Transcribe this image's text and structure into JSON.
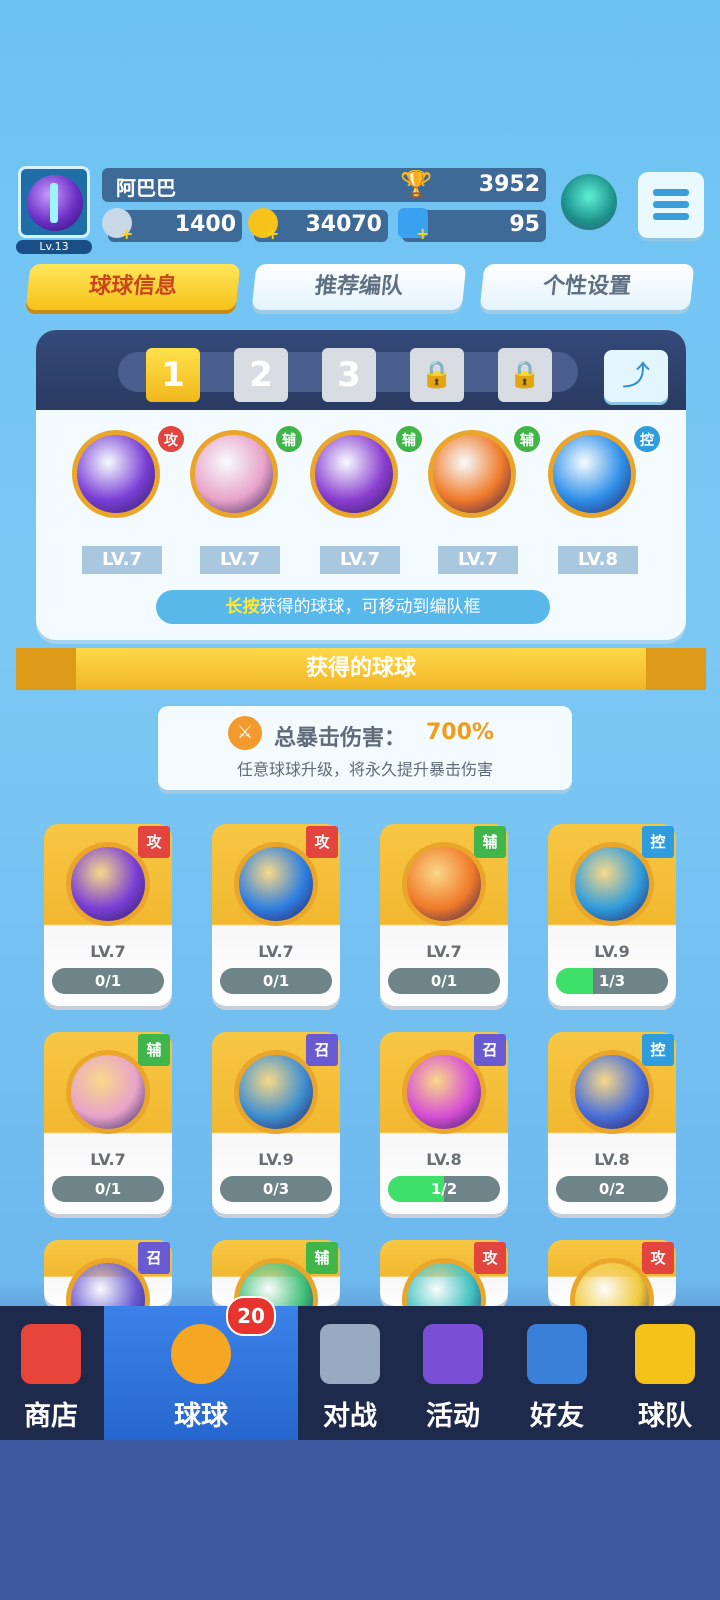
{
  "player": {
    "name": "阿巴巴",
    "level": "Lv.13",
    "trophies": "3952"
  },
  "resources": [
    {
      "name": "energy",
      "value": "1400",
      "icon": "energy-icon"
    },
    {
      "name": "gold",
      "value": "34070",
      "icon": "coin-icon"
    },
    {
      "name": "gems",
      "value": "95",
      "icon": "gem-icon"
    }
  ],
  "tabs": [
    "球球信息",
    "推荐编队",
    "个性设置"
  ],
  "team": {
    "slots": [
      "1",
      "2",
      "3",
      "🔒",
      "🔒"
    ],
    "balls": [
      {
        "type": "攻",
        "level": "LV.7",
        "color": "#7a3fd6"
      },
      {
        "type": "辅",
        "level": "LV.7",
        "color": "#e8a3c9"
      },
      {
        "type": "辅",
        "level": "LV.7",
        "color": "#8b3fd0"
      },
      {
        "type": "辅",
        "level": "LV.7",
        "color": "#f07a2a"
      },
      {
        "type": "控",
        "level": "LV.8",
        "color": "#2f8fe8"
      }
    ],
    "hint_key": "长按",
    "hint_text": "获得的球球，可移动到编队框"
  },
  "ribbon_title": "获得的球球",
  "crit": {
    "label": "总暴击伤害：",
    "value": "700%",
    "sub": "任意球球升级，将永久提升暴击伤害"
  },
  "collection": [
    {
      "type": "攻",
      "level": "LV.7",
      "progress": "0/1",
      "fill": 0,
      "color": "#7a3fd6"
    },
    {
      "type": "攻",
      "level": "LV.7",
      "progress": "0/1",
      "fill": 0,
      "color": "#2f7fe0"
    },
    {
      "type": "辅",
      "level": "LV.7",
      "progress": "0/1",
      "fill": 0,
      "color": "#f07a2a"
    },
    {
      "type": "控",
      "level": "LV.9",
      "progress": "1/3",
      "fill": 0.33,
      "color": "#2f9ddd"
    },
    {
      "type": "辅",
      "level": "LV.7",
      "progress": "0/1",
      "fill": 0,
      "color": "#e8a3c9"
    },
    {
      "type": "召",
      "level": "LV.9",
      "progress": "0/3",
      "fill": 0,
      "color": "#3f8fd0"
    },
    {
      "type": "召",
      "level": "LV.8",
      "progress": "1/2",
      "fill": 0.5,
      "color": "#d74fd6"
    },
    {
      "type": "控",
      "level": "LV.8",
      "progress": "0/2",
      "fill": 0,
      "color": "#4a6fd8"
    },
    {
      "type": "召",
      "level": "",
      "progress": "",
      "fill": 0,
      "color": "#6a5ad2"
    },
    {
      "type": "辅",
      "level": "",
      "progress": "",
      "fill": 0,
      "color": "#3fc07a"
    },
    {
      "type": "攻",
      "level": "",
      "progress": "",
      "fill": 0,
      "color": "#3fc0c0"
    },
    {
      "type": "攻",
      "level": "",
      "progress": "",
      "fill": 0,
      "color": "#f0c83a"
    }
  ],
  "nav": [
    {
      "label": "商店",
      "icon": "shop-icon"
    },
    {
      "label": "球球",
      "icon": "ball-icon",
      "badge": "20"
    },
    {
      "label": "对战",
      "icon": "swords-icon"
    },
    {
      "label": "活动",
      "icon": "party-popper-icon"
    },
    {
      "label": "好友",
      "icon": "friends-book-icon"
    },
    {
      "label": "球队",
      "icon": "whistle-icon"
    }
  ]
}
